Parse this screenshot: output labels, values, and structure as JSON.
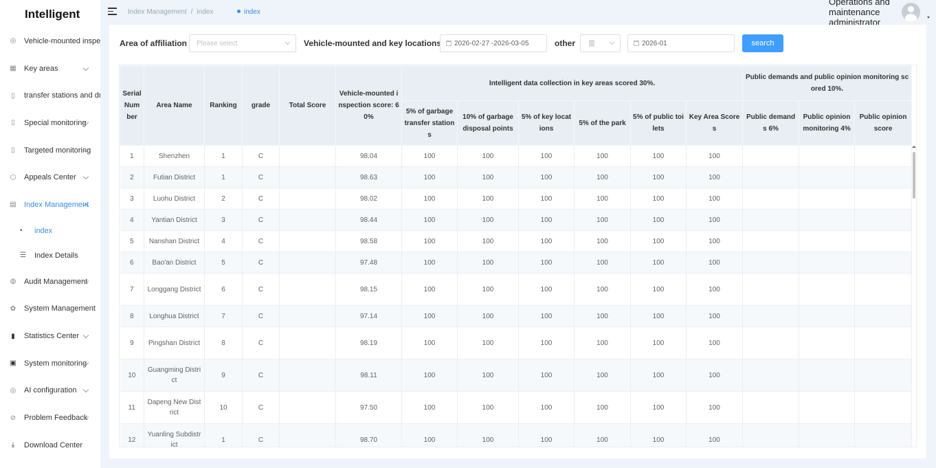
{
  "app": {
    "title": "Intelligent"
  },
  "sidebar": {
    "items": [
      {
        "label": "Vehicle-mounted inspecti",
        "icon": "location-icon",
        "chevron": false
      },
      {
        "label": "Key areas",
        "icon": "grid-icon",
        "chevron": true
      },
      {
        "label": "transfer stations and drop",
        "icon": "book-icon",
        "chevron": false
      },
      {
        "label": "Special monitoring",
        "icon": "book-icon",
        "chevron": true
      },
      {
        "label": "Targeted monitoring",
        "icon": "book-icon",
        "chevron": true
      },
      {
        "label": "Appeals Center",
        "icon": "cube-icon",
        "chevron": true
      },
      {
        "label": "Index Management",
        "icon": "chart-doc-icon",
        "chevron": true,
        "expanded": true
      },
      {
        "label": "Audit Management",
        "icon": "audit-icon",
        "chevron": true
      },
      {
        "label": "System Management",
        "icon": "settings-icon",
        "chevron": false
      },
      {
        "label": "Statistics Center",
        "icon": "bar-chart-icon",
        "chevron": true
      },
      {
        "label": "System monitoring",
        "icon": "monitor-icon",
        "chevron": true
      },
      {
        "label": "AI configuration",
        "icon": "ai-icon",
        "chevron": true
      },
      {
        "label": "Problem Feedback",
        "icon": "feedback-icon",
        "chevron": true
      },
      {
        "label": "Download Center",
        "icon": "download-icon",
        "chevron": false
      }
    ],
    "subitems": [
      {
        "label": "index",
        "icon": "doc-icon"
      },
      {
        "label": "Index Details",
        "icon": "list-icon"
      }
    ]
  },
  "header": {
    "breadcrumb": [
      "Index Management",
      "index"
    ],
    "active_tag": "index",
    "user_name": "Operations and maintenance administrator"
  },
  "filters": {
    "area_label": "Area of affiliation",
    "area_placeholder": "Please select",
    "vehicle_label": "Vehicle-mounted and key locations",
    "vehicle_range": "2026-02-27 -2026-03-05",
    "other_label": "other",
    "other_month": "2026-01",
    "search_label": "search"
  },
  "table": {
    "headers": {
      "serial": "Serial Number",
      "area": "Area Name",
      "ranking": "Ranking",
      "grade": "grade",
      "total": "Total Score",
      "vehicle": "Vehicle-mounted inspection score: 60%",
      "group_key": "Intelligent data collection in key areas scored 30%.",
      "group_public": "Public demands and public opinion monitoring scored 10%.",
      "garbage_transfer": "5% of garbage transfer stations",
      "garbage_disposal": "10% of garbage disposal points",
      "key_locations": "5% of key locations",
      "park": "5% of the park",
      "toilets": "5% of public toilets",
      "key_area_scores": "Key Area Scores",
      "public_demands": "Public demands 6%",
      "opinion_monitoring": "Public opinion monitoring 4%",
      "opinion_score": "Public opinion score"
    },
    "rows": [
      {
        "serial": "1",
        "area": "Shenzhen",
        "ranking": "1",
        "grade": "C",
        "total": "",
        "vehicle": "98.04",
        "gt": "100",
        "gd": "100",
        "kl": "100",
        "pk": "100",
        "tl": "100",
        "ka": "100",
        "pd": "",
        "om": "",
        "os": ""
      },
      {
        "serial": "2",
        "area": "Futian District",
        "ranking": "1",
        "grade": "C",
        "total": "",
        "vehicle": "98.63",
        "gt": "100",
        "gd": "100",
        "kl": "100",
        "pk": "100",
        "tl": "100",
        "ka": "100",
        "pd": "",
        "om": "",
        "os": ""
      },
      {
        "serial": "3",
        "area": "Luohu District",
        "ranking": "2",
        "grade": "C",
        "total": "",
        "vehicle": "98.02",
        "gt": "100",
        "gd": "100",
        "kl": "100",
        "pk": "100",
        "tl": "100",
        "ka": "100",
        "pd": "",
        "om": "",
        "os": ""
      },
      {
        "serial": "4",
        "area": "Yantian District",
        "ranking": "3",
        "grade": "C",
        "total": "",
        "vehicle": "98.44",
        "gt": "100",
        "gd": "100",
        "kl": "100",
        "pk": "100",
        "tl": "100",
        "ka": "100",
        "pd": "",
        "om": "",
        "os": ""
      },
      {
        "serial": "5",
        "area": "Nanshan District",
        "ranking": "4",
        "grade": "C",
        "total": "",
        "vehicle": "98.58",
        "gt": "100",
        "gd": "100",
        "kl": "100",
        "pk": "100",
        "tl": "100",
        "ka": "100",
        "pd": "",
        "om": "",
        "os": ""
      },
      {
        "serial": "6",
        "area": "Bao'an District",
        "ranking": "5",
        "grade": "C",
        "total": "",
        "vehicle": "97.48",
        "gt": "100",
        "gd": "100",
        "kl": "100",
        "pk": "100",
        "tl": "100",
        "ka": "100",
        "pd": "",
        "om": "",
        "os": ""
      },
      {
        "serial": "7",
        "area": "Longgang District",
        "ranking": "6",
        "grade": "C",
        "total": "",
        "vehicle": "98.15",
        "gt": "100",
        "gd": "100",
        "kl": "100",
        "pk": "100",
        "tl": "100",
        "ka": "100",
        "pd": "",
        "om": "",
        "os": ""
      },
      {
        "serial": "8",
        "area": "Longhua District",
        "ranking": "7",
        "grade": "C",
        "total": "",
        "vehicle": "97.14",
        "gt": "100",
        "gd": "100",
        "kl": "100",
        "pk": "100",
        "tl": "100",
        "ka": "100",
        "pd": "",
        "om": "",
        "os": ""
      },
      {
        "serial": "9",
        "area": "Pingshan District",
        "ranking": "8",
        "grade": "C",
        "total": "",
        "vehicle": "98.19",
        "gt": "100",
        "gd": "100",
        "kl": "100",
        "pk": "100",
        "tl": "100",
        "ka": "100",
        "pd": "",
        "om": "",
        "os": ""
      },
      {
        "serial": "10",
        "area": "Guangming District",
        "ranking": "9",
        "grade": "C",
        "total": "",
        "vehicle": "98.11",
        "gt": "100",
        "gd": "100",
        "kl": "100",
        "pk": "100",
        "tl": "100",
        "ka": "100",
        "pd": "",
        "om": "",
        "os": ""
      },
      {
        "serial": "11",
        "area": "Dapeng New District",
        "ranking": "10",
        "grade": "C",
        "total": "",
        "vehicle": "97.50",
        "gt": "100",
        "gd": "100",
        "kl": "100",
        "pk": "100",
        "tl": "100",
        "ka": "100",
        "pd": "",
        "om": "",
        "os": ""
      },
      {
        "serial": "12",
        "area": "Yuanling Subdistrict",
        "ranking": "1",
        "grade": "C",
        "total": "",
        "vehicle": "98.70",
        "gt": "100",
        "gd": "100",
        "kl": "100",
        "pk": "100",
        "tl": "100",
        "ka": "100",
        "pd": "",
        "om": "",
        "os": ""
      }
    ]
  },
  "colors": {
    "accent": "#409eff",
    "active_nav": "#3a8ee6",
    "header_bg": "#e8eef4",
    "page_bg": "#eef4fa"
  }
}
